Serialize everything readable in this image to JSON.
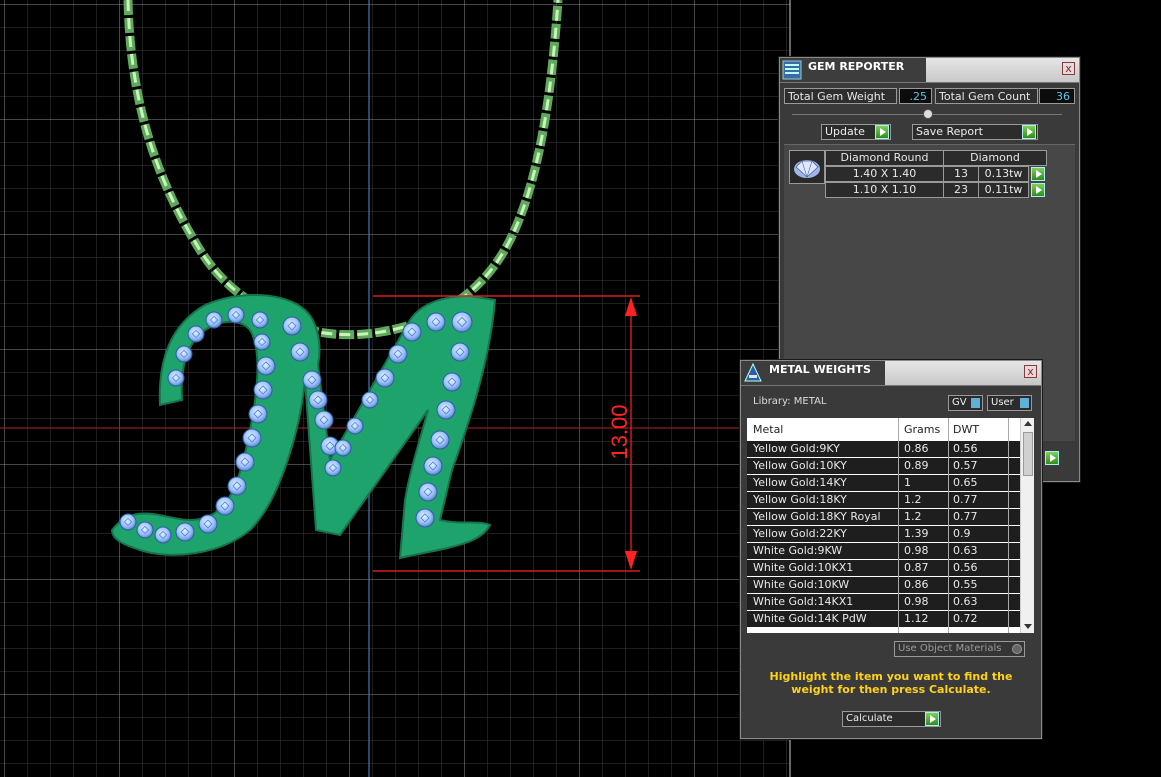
{
  "cad": {
    "dimension_label": "13.00",
    "grid_color": "#3a3a3a",
    "dimension_color": "#ff2222",
    "chain_color": "#9ee89a",
    "gem_color": "#9fc8ff",
    "metal_color": "#1ea06a"
  },
  "gem_reporter": {
    "title": "GEM REPORTER",
    "close_label": "x",
    "total_weight_label": "Total Gem Weight",
    "total_weight_value": ".25",
    "total_count_label": "Total Gem Count",
    "total_count_value": "36",
    "update_label": "Update",
    "save_report_label": "Save Report",
    "group_shape": "Diamond Round",
    "group_material": "Diamond",
    "rows": [
      {
        "size": "1.40 X 1.40",
        "count": "13",
        "weight": "0.13tw"
      },
      {
        "size": "1.10 X 1.10",
        "count": "23",
        "weight": "0.11tw"
      }
    ]
  },
  "metal_weights": {
    "title": "METAL WEIGHTS",
    "close_label": "x",
    "library_label": "Library: METAL",
    "gv_label": "GV",
    "user_label": "User",
    "columns": [
      "Metal",
      "Grams",
      "DWT"
    ],
    "rows": [
      {
        "metal": "Yellow Gold:9KY",
        "grams": "0.86",
        "dwt": "0.56"
      },
      {
        "metal": "Yellow Gold:10KY",
        "grams": "0.89",
        "dwt": "0.57"
      },
      {
        "metal": "Yellow Gold:14KY",
        "grams": "1",
        "dwt": "0.65"
      },
      {
        "metal": "Yellow Gold:18KY",
        "grams": "1.2",
        "dwt": "0.77"
      },
      {
        "metal": "Yellow Gold:18KY Royal",
        "grams": "1.2",
        "dwt": "0.77"
      },
      {
        "metal": "Yellow Gold:22KY",
        "grams": "1.39",
        "dwt": "0.9"
      },
      {
        "metal": "White Gold:9KW",
        "grams": "0.98",
        "dwt": "0.63"
      },
      {
        "metal": "White Gold:10KX1",
        "grams": "0.87",
        "dwt": "0.56"
      },
      {
        "metal": "White Gold:10KW",
        "grams": "0.86",
        "dwt": "0.55"
      },
      {
        "metal": "White Gold:14KX1",
        "grams": "0.98",
        "dwt": "0.63"
      },
      {
        "metal": "White Gold:14K PdW",
        "grams": "1.12",
        "dwt": "0.72"
      }
    ],
    "use_object_materials_label": "Use Object Materials",
    "instruction": "Highlight the item you want to find the weight for then press Calculate.",
    "calculate_label": "Calculate"
  }
}
